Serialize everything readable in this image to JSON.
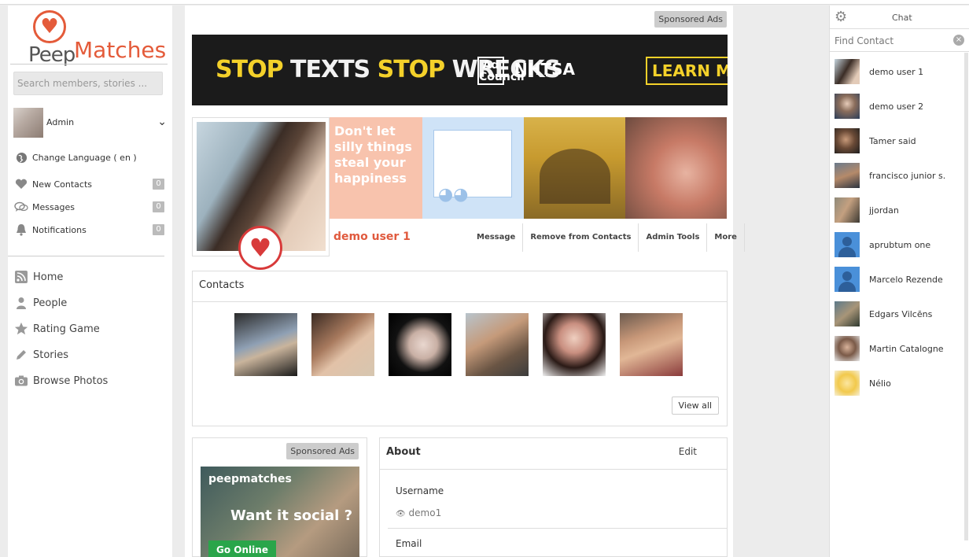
{
  "logo": {
    "part1": "Peep",
    "part2": "Matches"
  },
  "search": {
    "placeholder": "Search members, stories ..."
  },
  "user": {
    "name": "Admin"
  },
  "sidebar": {
    "change_language": "Change Language ( en )",
    "counters": [
      {
        "label": "New Contacts",
        "count": "0",
        "icon": "heart-icon"
      },
      {
        "label": "Messages",
        "count": "0",
        "icon": "messages-icon"
      },
      {
        "label": "Notifications",
        "count": "0",
        "icon": "bell-icon"
      }
    ],
    "nav": [
      {
        "label": "Home",
        "icon": "rss-icon"
      },
      {
        "label": "People",
        "icon": "person-icon"
      },
      {
        "label": "Rating Game",
        "icon": "star-icon"
      },
      {
        "label": "Stories",
        "icon": "pencil-icon"
      },
      {
        "label": "Browse Photos",
        "icon": "camera-icon"
      }
    ]
  },
  "ads": {
    "sponsored_label": "Sponsored Ads",
    "banner": {
      "stop1": "STOP",
      "texts": " TEXTS ",
      "stop2": "STOP",
      "wrecks": " WRECKS",
      "adcouncil": "Ad Council",
      "nhtsa": "NHTSA",
      "learn_more": "LEARN MOR"
    },
    "side_ad": {
      "brand": "peepmatches",
      "headline": "Want it social ?",
      "cta": "Go Online"
    }
  },
  "profile": {
    "name": "demo user 1",
    "cover_quote": "Don't let silly things steal your happiness",
    "actions": [
      "Message",
      "Remove from Contacts",
      "Admin Tools",
      "More"
    ]
  },
  "contacts": {
    "title": "Contacts",
    "view_all": "View all"
  },
  "about": {
    "title": "About",
    "edit": "Edit",
    "username_label": "Username",
    "username_value": "demo1",
    "email_label": "Email"
  },
  "chat": {
    "title": "Chat",
    "find_placeholder": "Find Contact",
    "users": [
      "demo user 1",
      "demo user 2",
      "Tamer said",
      "francisco junior s.",
      "jjordan",
      "aprubtum one",
      "Marcelo Rezende",
      "Edgars Vilcēns",
      "Martin Catalogne",
      "Nélio"
    ]
  },
  "colors": {
    "brand": "#e45b3a",
    "heart": "#d83a3a",
    "banner_yellow": "#f4d12a",
    "cta_green": "#2aa54a",
    "default_avatar": "#4a90d9"
  }
}
